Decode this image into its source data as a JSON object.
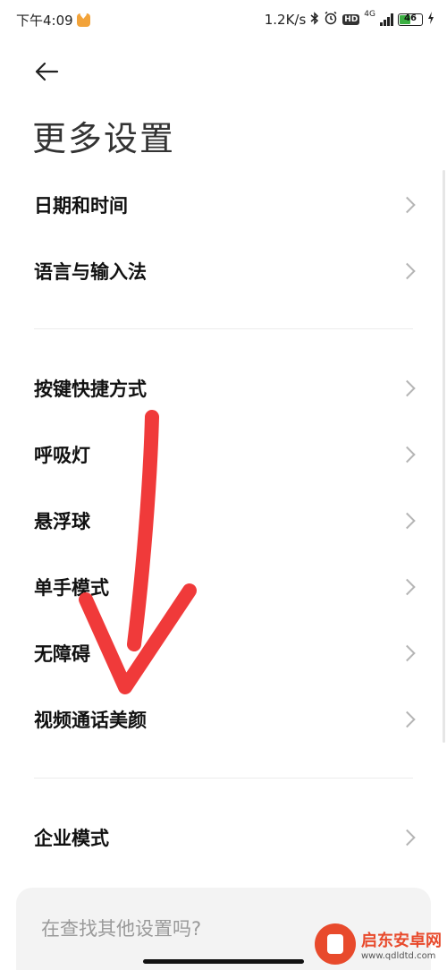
{
  "status_bar": {
    "time": "下午4:09",
    "speed": "1.2K/s",
    "hd": "HD",
    "network": "4G",
    "battery": "46"
  },
  "header": {
    "title": "更多设置"
  },
  "menu": {
    "group1": [
      {
        "label": "日期和时间"
      },
      {
        "label": "语言与输入法"
      }
    ],
    "group2": [
      {
        "label": "按键快捷方式"
      },
      {
        "label": "呼吸灯"
      },
      {
        "label": "悬浮球"
      },
      {
        "label": "单手模式"
      },
      {
        "label": "无障碍"
      },
      {
        "label": "视频通话美颜"
      }
    ],
    "group3": [
      {
        "label": "企业模式"
      }
    ]
  },
  "search": {
    "prompt": "在查找其他设置吗?"
  },
  "watermark": {
    "name": "启东安卓网",
    "url": "www.qdldtd.com"
  },
  "colors": {
    "arrow": "#f03a3a",
    "battery": "#3cb043",
    "watermark": "#e84a2c"
  },
  "icons": [
    "back-arrow-icon",
    "chevron-right-icon",
    "bluetooth-icon",
    "alarm-icon",
    "signal-icon",
    "battery-icon",
    "charging-icon"
  ]
}
